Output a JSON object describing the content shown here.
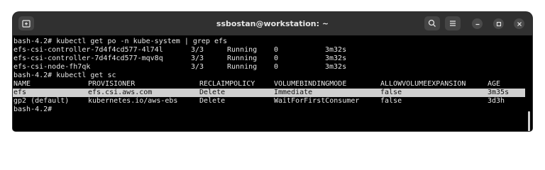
{
  "window": {
    "title": "ssbostan@workstation: ~",
    "buttons": [
      "new-tab",
      "search",
      "menu",
      "minimize",
      "maximize",
      "close"
    ]
  },
  "terminal": {
    "lines": [
      "bash-4.2# kubectl get po -n kube-system | grep efs",
      "bash-4.2# kubectl get sc",
      "bash-4.2#"
    ],
    "pods": [
      {
        "name": "efs-csi-controller-7d4f4cd577-4l74l",
        "ready": "3/3",
        "status": "Running",
        "restarts": "0",
        "age": "3m32s"
      },
      {
        "name": "efs-csi-controller-7d4f4cd577-mqv8q",
        "ready": "3/3",
        "status": "Running",
        "restarts": "0",
        "age": "3m32s"
      },
      {
        "name": "efs-csi-node-fh7qk",
        "ready": "3/3",
        "status": "Running",
        "restarts": "0",
        "age": "3m32s"
      }
    ],
    "sc_headers": [
      "NAME",
      "PROVISIONER",
      "RECLAIMPOLICY",
      "VOLUMEBINDINGMODE",
      "ALLOWVOLUMEEXPANSION",
      "AGE"
    ],
    "sc_rows": [
      [
        "efs",
        "efs.csi.aws.com",
        "Delete",
        "Immediate",
        "false",
        "3m35s"
      ],
      [
        "gp2 (default)",
        "kubernetes.io/aws-ebs",
        "Delete",
        "WaitForFirstConsumer",
        "false",
        "3d3h"
      ]
    ],
    "selected_row": 0
  },
  "colors": {
    "titlebar": "#303030",
    "terminal_bg": "#000000",
    "text": "#e6e6e6",
    "selection": "#cfcfcf"
  }
}
